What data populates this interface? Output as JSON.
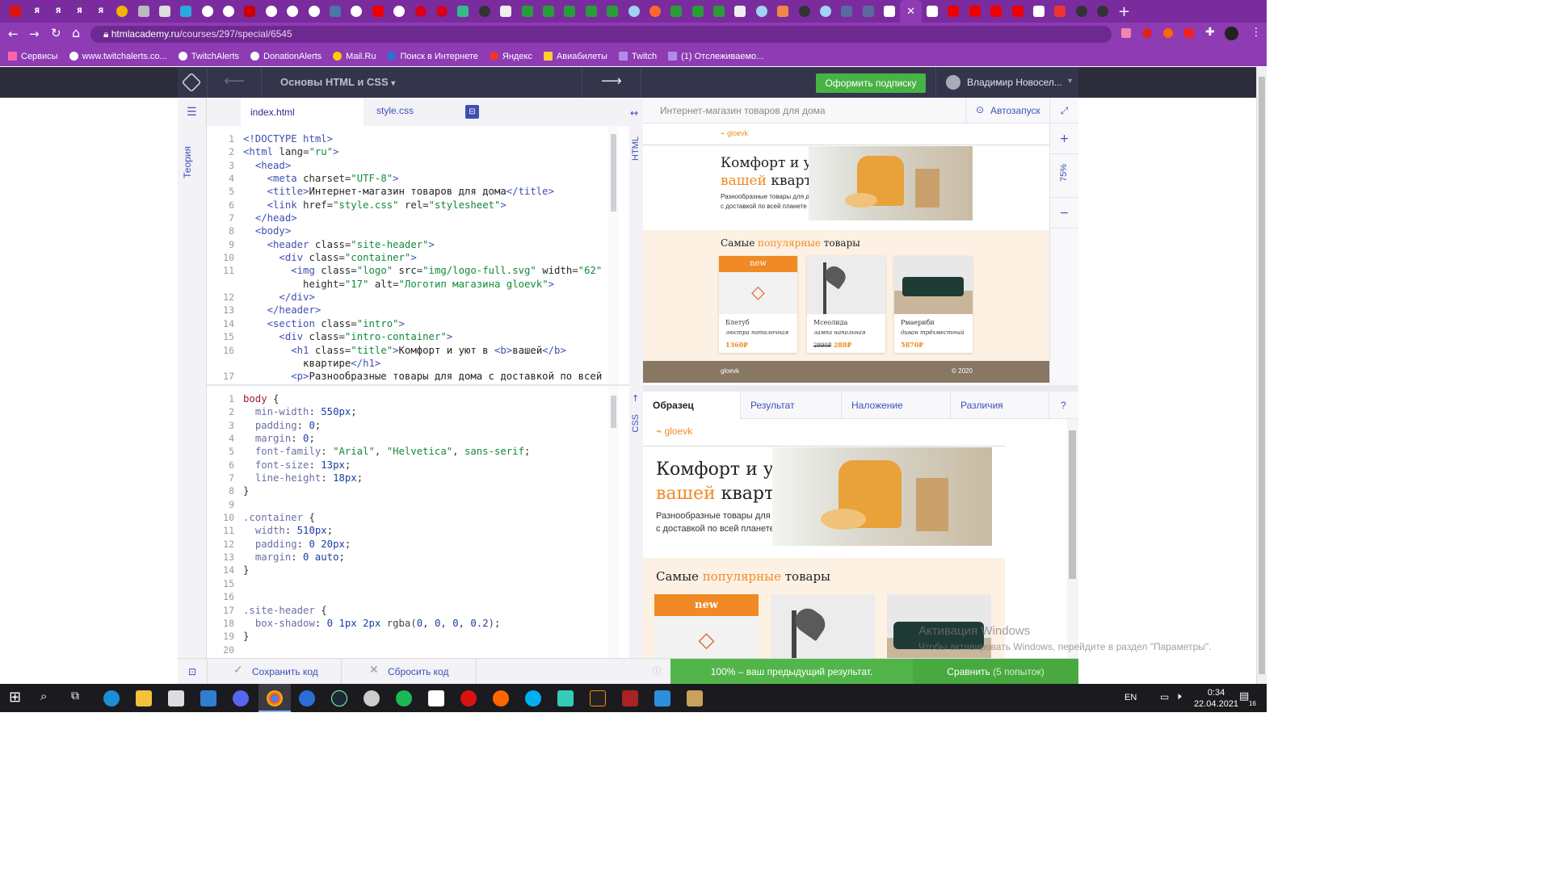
{
  "browser": {
    "url_host": "htmlacademy.ru",
    "url_path": "/courses/297/special/6545",
    "bookmarks": [
      "Сервисы",
      "www.twitchalerts.co...",
      "TwitchAlerts",
      "DonationAlerts",
      "Mail.Ru",
      "Поиск в Интернете",
      "Яндекс",
      "Авиабилеты",
      "Twitch",
      "(1) Отслеживаемо..."
    ],
    "tab_letters": [
      "Я",
      "Я",
      "Я",
      "Я"
    ]
  },
  "academy": {
    "course_title": "Основы HTML и CSS",
    "subscribe_label": "Оформить подписку",
    "user_name": "Владимир Новосел...",
    "sidebar_theory": "Теория"
  },
  "editor": {
    "tab_html": "index.html",
    "tab_css": "style.css",
    "html_label": "HTML",
    "css_label": "CSS"
  },
  "preview": {
    "page_title": "Интернет-магазин товаров для дома",
    "autorun_label": "Автозапуск",
    "zoom": "75%",
    "logo": "gloevk",
    "h1_a": "Комфорт и уют в",
    "h1_b": "вашей",
    "h1_c": "квартире",
    "subtitle_1": "Разнообразные товары для дома",
    "subtitle_2": "с доставкой по всей планете",
    "popular_a": "Самые",
    "popular_b": "популярные",
    "popular_c": "товары",
    "badge_new": "new",
    "products": [
      {
        "name": "Блетуб",
        "desc": "люстра потолочная",
        "old": "",
        "price": "1360₽"
      },
      {
        "name": "Мсеолида",
        "desc": "лампа напольная",
        "old": "2890₽",
        "price": "288₽"
      },
      {
        "name": "Рмаериби",
        "desc": "диван трёхместный",
        "old": "",
        "price": "5870₽"
      }
    ],
    "footer_logo": "gloevk",
    "footer_copy": "© 2020"
  },
  "compare": {
    "tabs": [
      "Образец",
      "Результат",
      "Наложение",
      "Различия",
      "?"
    ]
  },
  "bottom": {
    "save_label": "Сохранить код",
    "reset_label": "Сбросить код",
    "result_text": "100% – ваш предыдущий результат.",
    "compare_label": "Сравнить",
    "compare_attempts": "(5 попыток)"
  },
  "watermark": {
    "title": "Активация Windows",
    "text": "Чтобы активировать Windows, перейдите в раздел \"Параметры\"."
  },
  "taskbar": {
    "lang": "EN",
    "time": "0:34",
    "date": "22.04.2021",
    "notif_count": "16"
  }
}
